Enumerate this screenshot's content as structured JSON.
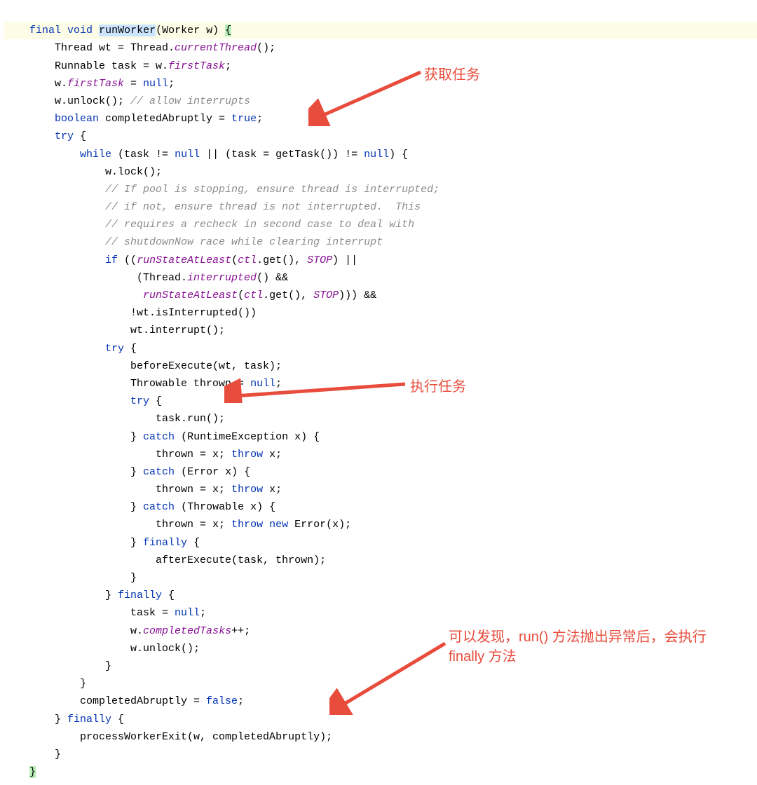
{
  "code": {
    "line1_final": "final",
    "line1_void": "void",
    "line1_method": "runWorker",
    "line1_params": "(Worker w) ",
    "line1_brace": "{",
    "line2": "        Thread wt = Thread.",
    "line2_field": "currentThread",
    "line2_end": "();",
    "line3": "        Runnable task = w.",
    "line3_field": "firstTask",
    "line3_end": ";",
    "line4": "        w.",
    "line4_field": "firstTask",
    "line4_mid": " = ",
    "line4_null": "null",
    "line4_end": ";",
    "line5": "        w.unlock(); ",
    "line5_comment": "// allow interrupts",
    "line6_pre": "        ",
    "line6_boolean": "boolean",
    "line6_mid": " completedAbruptly = ",
    "line6_true": "true",
    "line6_end": ";",
    "line7_pre": "        ",
    "line7_try": "try",
    "line7_end": " {",
    "line8_pre": "            ",
    "line8_while": "while",
    "line8_mid1": " (task != ",
    "line8_null1": "null",
    "line8_mid2": " || (task = getTask()) != ",
    "line8_null2": "null",
    "line8_end": ") {",
    "line9": "                w.lock();",
    "line10": "                ",
    "line10_comment": "// If pool is stopping, ensure thread is interrupted;",
    "line11": "                ",
    "line11_comment": "// if not, ensure thread is not interrupted.  This",
    "line12": "                ",
    "line12_comment": "// requires a recheck in second case to deal with",
    "line13": "                ",
    "line13_comment": "// shutdownNow race while clearing interrupt",
    "line14_pre": "                ",
    "line14_if": "if",
    "line14_mid1": " ((",
    "line14_fn1": "runStateAtLeast",
    "line14_mid2": "(",
    "line14_ctl": "ctl",
    "line14_mid3": ".get(), ",
    "line14_stop": "STOP",
    "line14_end": ") ||",
    "line15_pre": "                     (Thread.",
    "line15_fn": "interrupted",
    "line15_end": "() &&",
    "line16_pre": "                      ",
    "line16_fn": "runStateAtLeast",
    "line16_mid1": "(",
    "line16_ctl": "ctl",
    "line16_mid2": ".get(), ",
    "line16_stop": "STOP",
    "line16_end": "))) &&",
    "line17": "                    !wt.isInterrupted())",
    "line18": "                    wt.interrupt();",
    "line19_pre": "                ",
    "line19_try": "try",
    "line19_end": " {",
    "line20": "                    beforeExecute(wt, task);",
    "line21_pre": "                    Throwable thrown = ",
    "line21_null": "null",
    "line21_end": ";",
    "line22_pre": "                    ",
    "line22_try": "try",
    "line22_end": " {",
    "line23": "                        task.run();",
    "line24_pre": "                    } ",
    "line24_catch": "catch",
    "line24_end": " (RuntimeException x) {",
    "line25_pre": "                        thrown = x; ",
    "line25_throw": "throw",
    "line25_end": " x;",
    "line26_pre": "                    } ",
    "line26_catch": "catch",
    "line26_end": " (Error x) {",
    "line27_pre": "                        thrown = x; ",
    "line27_throw": "throw",
    "line27_end": " x;",
    "line28_pre": "                    } ",
    "line28_catch": "catch",
    "line28_end": " (Throwable x) {",
    "line29_pre": "                        thrown = x; ",
    "line29_throw": "throw",
    "line29_mid": " ",
    "line29_new": "new",
    "line29_end": " Error(x);",
    "line30_pre": "                    } ",
    "line30_finally": "finally",
    "line30_end": " {",
    "line31": "                        afterExecute(task, thrown);",
    "line32": "                    }",
    "line33_pre": "                } ",
    "line33_finally": "finally",
    "line33_end": " {",
    "line34_pre": "                    task = ",
    "line34_null": "null",
    "line34_end": ";",
    "line35_pre": "                    w.",
    "line35_field": "completedTasks",
    "line35_end": "++;",
    "line36": "                    w.unlock();",
    "line37": "                }",
    "line38": "            }",
    "line39_pre": "            completedAbruptly = ",
    "line39_false": "false",
    "line39_end": ";",
    "line40_pre": "        } ",
    "line40_finally": "finally",
    "line40_end": " {",
    "line41": "            processWorkerExit(w, completedAbruptly);",
    "line42": "        }",
    "line43_pre": "    ",
    "line43_brace": "}"
  },
  "annotations": {
    "a1": "获取任务",
    "a2": "执行任务",
    "a3": "可以发现，run() 方法抛出异常后，会执行 finally 方法"
  }
}
